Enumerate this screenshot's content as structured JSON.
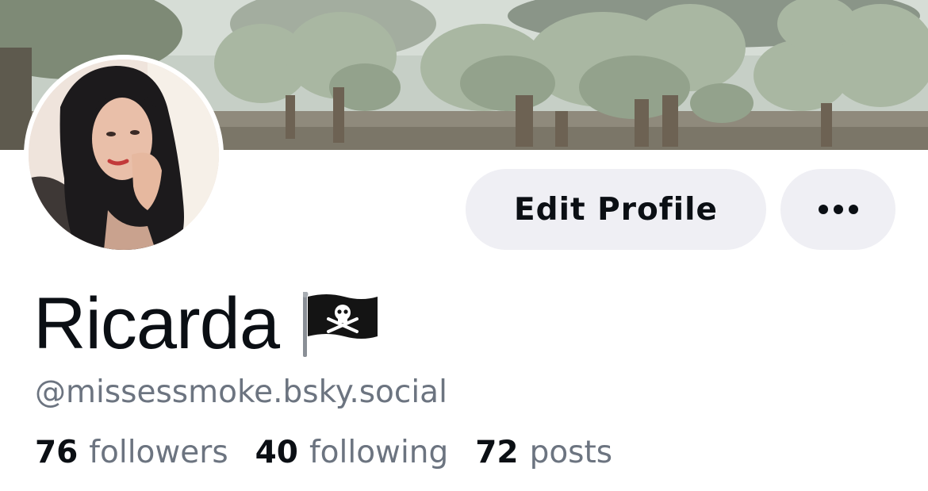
{
  "profile": {
    "display_name": "Ricarda",
    "name_emoji": "pirate-flag-icon",
    "handle": "@missessmoke.bsky.social"
  },
  "actions": {
    "edit_profile_label": "Edit Profile",
    "more_icon": "ellipsis-icon"
  },
  "stats": {
    "followers_count": "76",
    "followers_label": "followers",
    "following_count": "40",
    "following_label": "following",
    "posts_count": "72",
    "posts_label": "posts"
  },
  "colors": {
    "text_primary": "#0b0f14",
    "text_secondary": "#6c7480",
    "button_background": "#efeff4"
  }
}
